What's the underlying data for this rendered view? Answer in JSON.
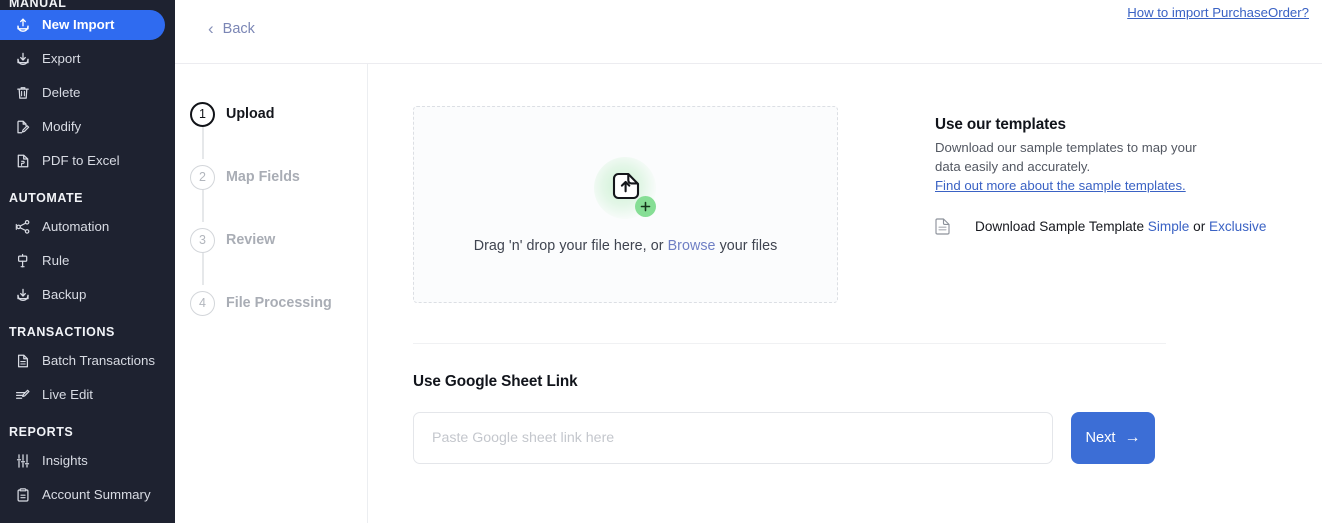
{
  "sidebar": {
    "groups": [
      {
        "label": "MANUAL",
        "items": [
          {
            "label": "New Import",
            "icon": "upload-arrow-icon",
            "active": true
          },
          {
            "label": "Export",
            "icon": "download-arrow-icon",
            "active": false
          },
          {
            "label": "Delete",
            "icon": "trash-icon",
            "active": false
          },
          {
            "label": "Modify",
            "icon": "file-edit-icon",
            "active": false
          },
          {
            "label": "PDF to Excel",
            "icon": "pdf-file-icon",
            "active": false
          }
        ]
      },
      {
        "label": "AUTOMATE",
        "items": [
          {
            "label": "Automation",
            "icon": "share-nodes-icon",
            "active": false
          },
          {
            "label": "Rule",
            "icon": "flag-rule-icon",
            "active": false
          },
          {
            "label": "Backup",
            "icon": "download-arrow-icon",
            "active": false
          }
        ]
      },
      {
        "label": "TRANSACTIONS",
        "items": [
          {
            "label": "Batch Transactions",
            "icon": "document-icon",
            "active": false
          },
          {
            "label": "Live Edit",
            "icon": "pencil-lines-icon",
            "active": false
          }
        ]
      },
      {
        "label": "REPORTS",
        "items": [
          {
            "label": "Insights",
            "icon": "sliders-icon",
            "active": false
          },
          {
            "label": "Account Summary",
            "icon": "clipboard-icon",
            "active": false
          }
        ]
      }
    ]
  },
  "topbar": {
    "back_label": "Back",
    "back_chevron": "‹",
    "help_link": "How to import PurchaseOrder?"
  },
  "stepper": {
    "steps": [
      {
        "number": "1",
        "label": "Upload",
        "active": true
      },
      {
        "number": "2",
        "label": "Map Fields",
        "active": false
      },
      {
        "number": "3",
        "label": "Review",
        "active": false
      },
      {
        "number": "4",
        "label": "File Processing",
        "active": false
      }
    ]
  },
  "dropzone": {
    "text_before": "Drag 'n' drop your file here, or ",
    "browse_label": "Browse",
    "text_after": " your files"
  },
  "templates": {
    "title": "Use our templates",
    "description": "Download our sample templates to map your data easily and accurately.",
    "more_link": "Find out more about the sample templates.",
    "download_label": "Download Sample Template ",
    "simple_label": "Simple",
    "or_label": " or ",
    "exclusive_label": "Exclusive"
  },
  "google_sheet": {
    "title": "Use Google Sheet Link",
    "input_value": "",
    "input_placeholder": "Paste Google sheet link here",
    "next_label": "Next",
    "next_arrow": "→"
  },
  "colors": {
    "sidebar_bg": "#1e2230",
    "sidebar_active": "#2f6bf0",
    "link_blue": "#3a62c4",
    "primary_button": "#3c6ed6",
    "accent_green": "#86de95"
  }
}
